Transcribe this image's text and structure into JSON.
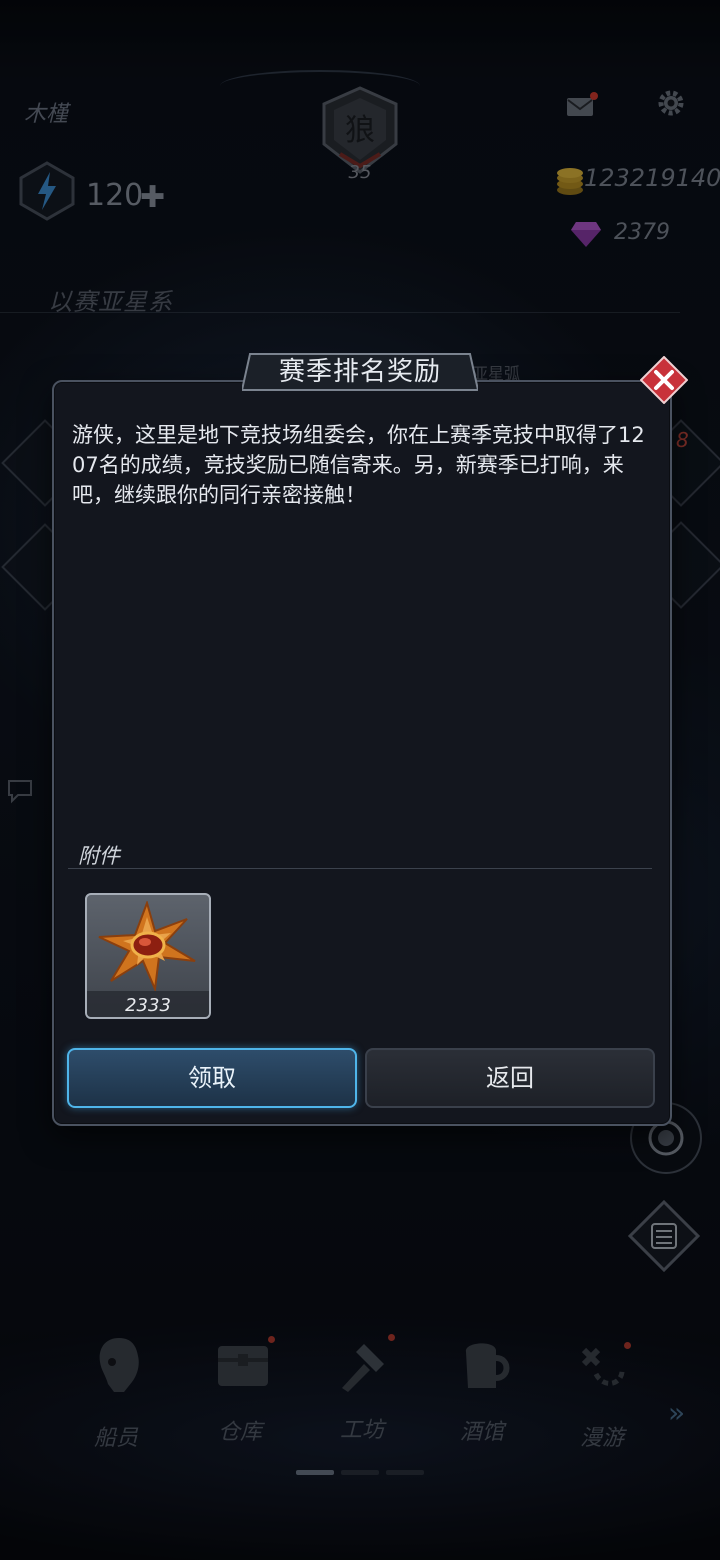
{
  "hud": {
    "player_name": "木槿",
    "rank_level": "35",
    "energy": "120",
    "energy_plus": "✚",
    "coins": "123219140",
    "gems": "2379",
    "system_name": "以赛亚星系",
    "behind_label": "亚星弧",
    "side_badge": "8"
  },
  "dialog": {
    "title": "赛季排名奖励",
    "message": "游侠，这里是地下竞技场组委会，你在上赛季竞技中取得了1207名的成绩，竞技奖励已随信寄来。另，新赛季已打响，来吧，继续跟你的同行亲密接触！",
    "attachments_label": "附件",
    "attachment": {
      "icon": "medal-icon",
      "count": "2333"
    },
    "claim_label": "领取",
    "back_label": "返回"
  },
  "nav": {
    "items": [
      {
        "label": "船员",
        "icon": "crew-icon"
      },
      {
        "label": "仓库",
        "icon": "chest-icon"
      },
      {
        "label": "工坊",
        "icon": "workshop-icon"
      },
      {
        "label": "酒馆",
        "icon": "beer-icon"
      },
      {
        "label": "漫游",
        "icon": "roam-icon"
      }
    ],
    "more": "»"
  },
  "colors": {
    "accent": "#4fb5ea",
    "close": "#c8323a",
    "badge": "#d23a2f"
  }
}
